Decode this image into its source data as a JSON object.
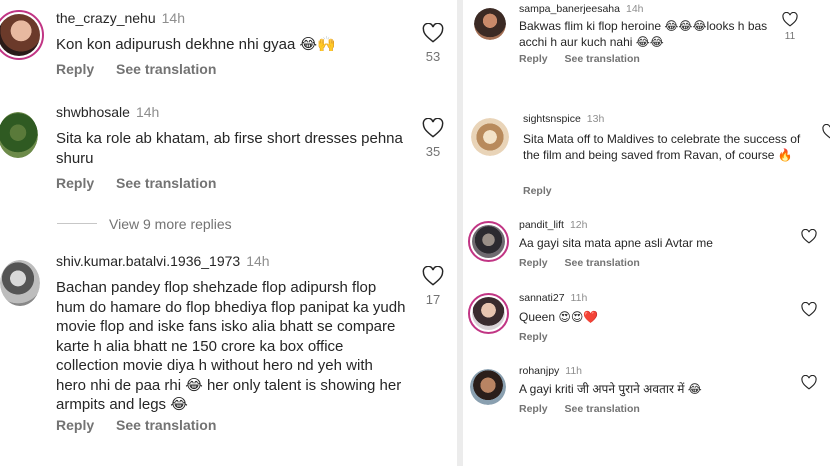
{
  "left_comments": [
    {
      "username": "the_crazy_nehu",
      "time": "14h",
      "text": "Kon kon adipurush dekhne nhi gyaa 😂🙌",
      "likes": "53",
      "reply": "Reply",
      "translate": "See translation"
    },
    {
      "username": "shwbhosale",
      "time": "14h",
      "text": "Sita ka role ab khatam, ab firse short dresses pehna shuru",
      "likes": "35",
      "reply": "Reply",
      "translate": "See translation"
    },
    {
      "username": "shiv.kumar.batalvi.1936_1973",
      "time": "14h",
      "text": "Bachan pandey flop shehzade flop adipursh flop hum do hamare do flop bhediya flop panipat ka yudh movie flop and iske fans isko alia bhatt se compare karte h alia bhatt ne 150 crore ka box office collection movie diya h without hero nd yeh with hero nhi de paa rhi 😂 her only talent is showing her armpits and legs 😂",
      "likes": "17",
      "reply": "Reply",
      "translate": "See translation"
    }
  ],
  "view_more_replies": "View 9 more replies",
  "right_comments": [
    {
      "username": "sampa_banerjeesaha",
      "time": "14h",
      "text": "Bakwas flim ki flop heroine 😂😂😂looks h bas acchi h aur kuch nahi 😂😂",
      "likes": "11",
      "reply": "Reply",
      "translate": "See translation"
    },
    {
      "username": "sightsnspice",
      "time": "13h",
      "text": "Sita Mata off to Maldives to celebrate the success of the film and being saved from Ravan, of course 🔥",
      "reply": "Reply"
    },
    {
      "username": "pandit_lift",
      "time": "12h",
      "text": "Aa gayi sita mata apne asli Avtar me",
      "reply": "Reply",
      "translate": "See translation"
    },
    {
      "username": "sannati27",
      "time": "11h",
      "text": "Queen 😍😍❤️",
      "reply": "Reply"
    },
    {
      "username": "rohanjpy",
      "time": "11h",
      "text": "A gayi kriti जी अपने पुराने अवतार में 😂",
      "reply": "Reply",
      "translate": "See translation"
    }
  ],
  "colors": {
    "story_ring": "#c13584",
    "muted": "#737373",
    "text": "#262626"
  }
}
